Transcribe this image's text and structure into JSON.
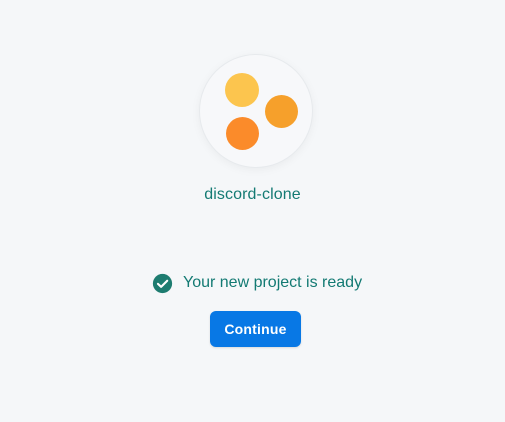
{
  "project": {
    "name": "discord-clone",
    "logo_icon": "project-logo-dots-icon"
  },
  "status": {
    "icon": "check-circle-icon",
    "text": "Your new project is ready"
  },
  "continue_button": {
    "label": "Continue"
  },
  "colors": {
    "background": "#f5f7f9",
    "teal_text": "#137a73",
    "check_icon": "#1d7c70",
    "button_blue": "#0878e5",
    "dot_yellow": "#fcc54e",
    "dot_orange_right": "#f6a02b",
    "dot_orange_bottom": "#fb8b2a"
  }
}
